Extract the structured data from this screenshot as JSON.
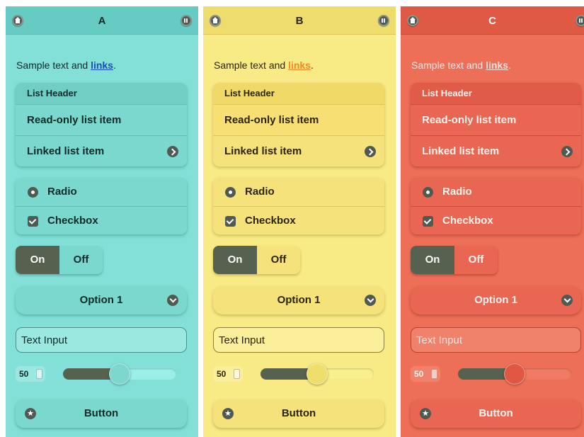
{
  "colors": {
    "theme_a": "#82e0d8",
    "theme_b": "#f8ea85",
    "theme_c": "#ed6f58",
    "active_dark": "#56614f"
  },
  "icons": {
    "header_left": "home-icon",
    "header_right": "grid-icon",
    "list_link": "chevron-right-icon",
    "select": "chevron-down-icon",
    "button": "star-icon"
  },
  "panels": [
    {
      "title": "A",
      "sample_prefix": "Sample text and ",
      "sample_link": "links",
      "sample_suffix": ".",
      "list_header": "List Header",
      "readonly_item": "Read-only list item",
      "linked_item": "Linked list item",
      "radio_label": "Radio",
      "checkbox_label": "Checkbox",
      "toggle_on": "On",
      "toggle_off": "Off",
      "select_value": "Option 1",
      "text_input_value": "Text Input",
      "slider_value": "50",
      "button_label": "Button"
    },
    {
      "title": "B",
      "sample_prefix": "Sample text and ",
      "sample_link": "links",
      "sample_suffix": ".",
      "list_header": "List Header",
      "readonly_item": "Read-only list item",
      "linked_item": "Linked list item",
      "radio_label": "Radio",
      "checkbox_label": "Checkbox",
      "toggle_on": "On",
      "toggle_off": "Off",
      "select_value": "Option 1",
      "text_input_value": "Text Input",
      "slider_value": "50",
      "button_label": "Button"
    },
    {
      "title": "C",
      "sample_prefix": "Sample text and ",
      "sample_link": "links",
      "sample_suffix": ".",
      "list_header": "List Header",
      "readonly_item": "Read-only list item",
      "linked_item": "Linked list item",
      "radio_label": "Radio",
      "checkbox_label": "Checkbox",
      "toggle_on": "On",
      "toggle_off": "Off",
      "select_value": "Option 1",
      "text_input_value": "Text Input",
      "slider_value": "50",
      "button_label": "Button"
    }
  ]
}
